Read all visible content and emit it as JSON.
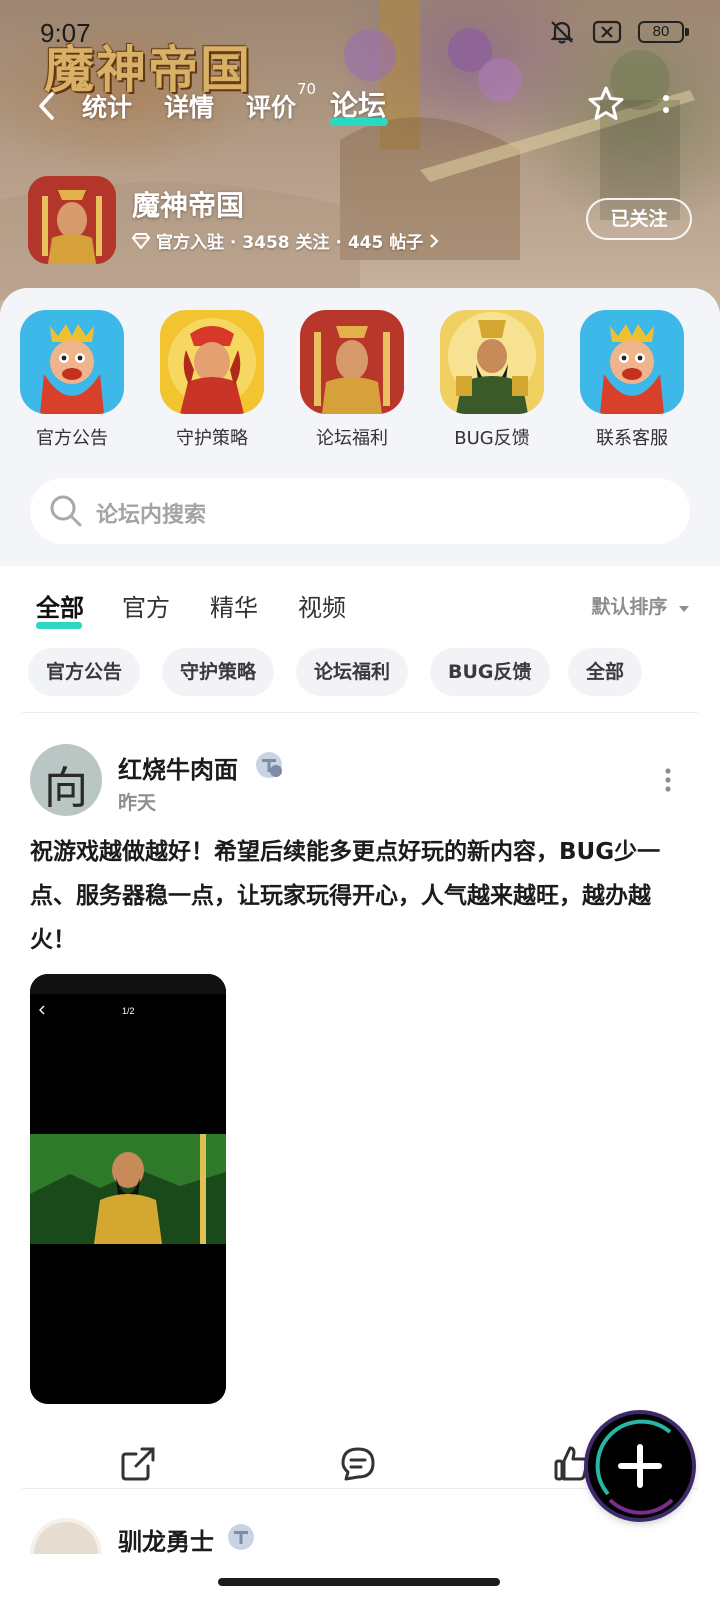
{
  "status_bar": {
    "time": "9:07",
    "battery": "80"
  },
  "header": {
    "game_logo": "魔神帝国",
    "nav_tabs": [
      {
        "label": "统计",
        "active": false
      },
      {
        "label": "详情",
        "active": false
      },
      {
        "label": "评价",
        "badge": "70",
        "active": false
      },
      {
        "label": "论坛",
        "active": true
      }
    ],
    "accent_color": "#28d9c4"
  },
  "app": {
    "name": "魔神帝国",
    "meta": "官方入驻 · 3458 关注 · 445 帖子",
    "follow_label": "已关注"
  },
  "quick_links": [
    {
      "label": "官方公告",
      "icon": "king-portrait"
    },
    {
      "label": "守护策略",
      "icon": "warrior-portrait"
    },
    {
      "label": "论坛福利",
      "icon": "gold-hero-portrait"
    },
    {
      "label": "BUG反馈",
      "icon": "general-portrait"
    },
    {
      "label": "联系客服",
      "icon": "king-portrait"
    }
  ],
  "search": {
    "placeholder": "论坛内搜索"
  },
  "tabs": [
    {
      "label": "全部",
      "active": true
    },
    {
      "label": "官方",
      "active": false
    },
    {
      "label": "精华",
      "active": false
    },
    {
      "label": "视频",
      "active": false
    }
  ],
  "sort_label": "默认排序",
  "chips": [
    "官方公告",
    "守护策略",
    "论坛福利",
    "BUG反馈",
    "全部"
  ],
  "post": {
    "author": "红烧牛肉面",
    "time": "昨天",
    "content": "祝游戏越做越好！希望后续能多更点好玩的新内容，BUG少一点、服务器稳一点，让玩家玩得开心，人气越来越旺，越办越火！",
    "image_page": "1/2"
  },
  "next_post": {
    "author": "驯龙勇士"
  }
}
